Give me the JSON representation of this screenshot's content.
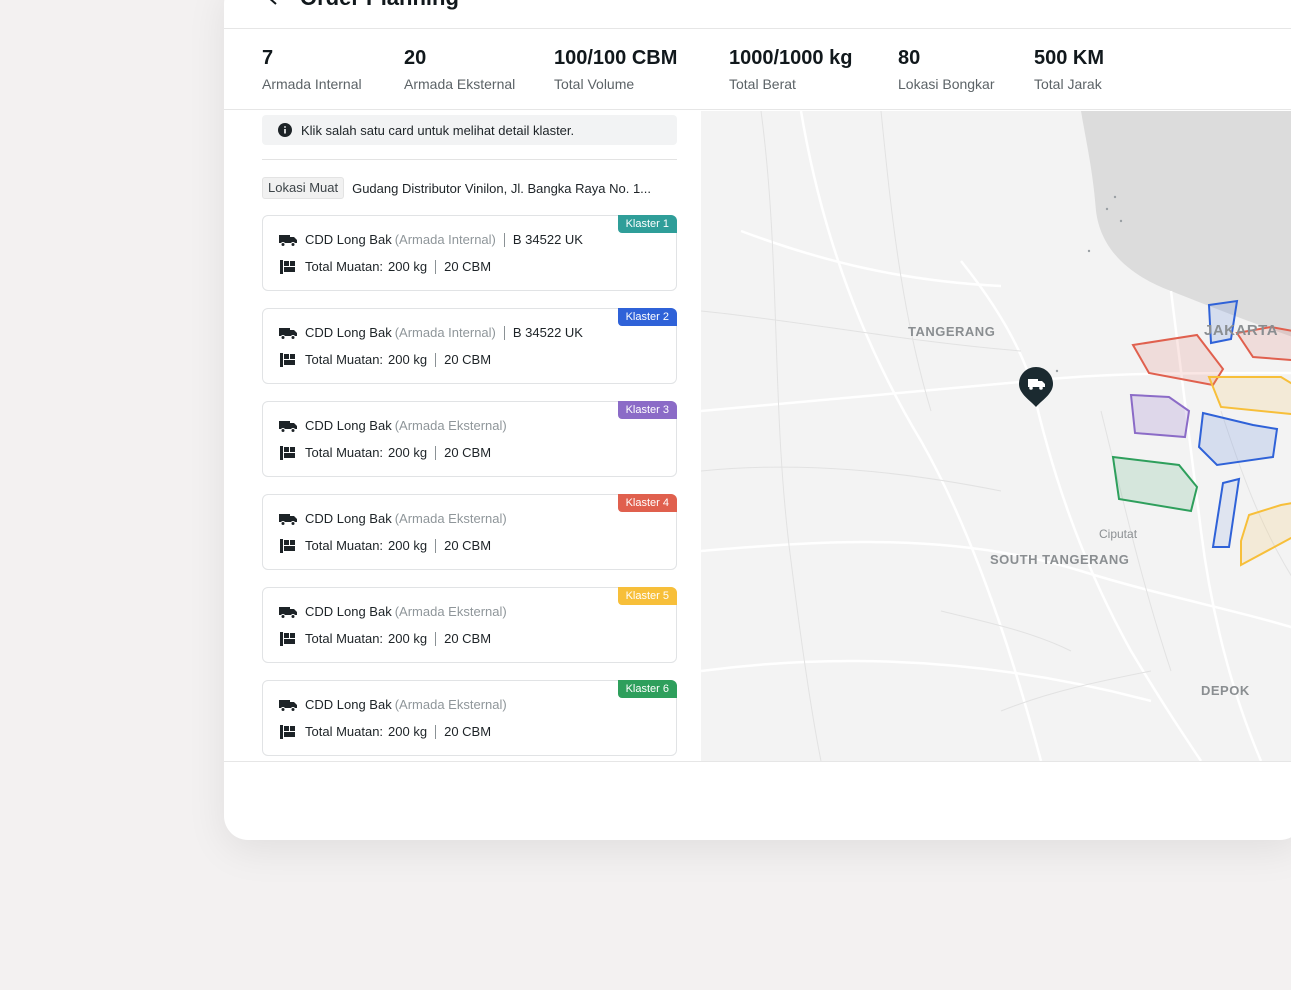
{
  "header": {
    "title": "Order Planning"
  },
  "stats": [
    {
      "value": "7",
      "label": "Armada Internal"
    },
    {
      "value": "20",
      "label": "Armada Eksternal"
    },
    {
      "value": "100/100 CBM",
      "label": "Total Volume"
    },
    {
      "value": "1000/1000 kg",
      "label": "Total Berat"
    },
    {
      "value": "80",
      "label": "Lokasi Bongkar"
    },
    {
      "value": "500 KM",
      "label": "Total Jarak"
    }
  ],
  "info": {
    "text": "Klik salah satu card untuk melihat detail klaster."
  },
  "load": {
    "tag": "Lokasi Muat",
    "address": "Gudang Distributor Vinilon, Jl. Bangka Raya No. 1..."
  },
  "cards": [
    {
      "badge": "Klaster 1",
      "badge_color": "#2f9e99",
      "vehicle": "CDD Long Bak",
      "fleet": "(Armada Internal)",
      "plate": "B 34522 UK",
      "load_label": "Total Muatan:",
      "weight": "200 kg",
      "volume": "20 CBM"
    },
    {
      "badge": "Klaster 2",
      "badge_color": "#2f62d8",
      "vehicle": "CDD Long Bak",
      "fleet": "(Armada Internal)",
      "plate": "B 34522 UK",
      "load_label": "Total Muatan:",
      "weight": "200 kg",
      "volume": "20 CBM"
    },
    {
      "badge": "Klaster 3",
      "badge_color": "#8b6bc7",
      "vehicle": "CDD Long Bak",
      "fleet": "(Armada Eksternal)",
      "plate": "",
      "load_label": "Total Muatan:",
      "weight": "200 kg",
      "volume": "20 CBM"
    },
    {
      "badge": "Klaster 4",
      "badge_color": "#e0604e",
      "vehicle": "CDD Long Bak",
      "fleet": "(Armada Eksternal)",
      "plate": "",
      "load_label": "Total Muatan:",
      "weight": "200 kg",
      "volume": "20 CBM"
    },
    {
      "badge": "Klaster 5",
      "badge_color": "#f7bf3a",
      "vehicle": "CDD Long Bak",
      "fleet": "(Armada Eksternal)",
      "plate": "",
      "load_label": "Total Muatan:",
      "weight": "200 kg",
      "volume": "20 CBM"
    },
    {
      "badge": "Klaster 6",
      "badge_color": "#2e9f5c",
      "vehicle": "CDD Long Bak",
      "fleet": "(Armada Eksternal)",
      "plate": "",
      "load_label": "Total Muatan:",
      "weight": "200 kg",
      "volume": "20 CBM"
    }
  ],
  "map": {
    "labels": {
      "tangerang": "TANGERANG",
      "jakarta": "JAKARTA",
      "south_tangerang": "SOUTH TANGERANG",
      "ciputat": "Ciputat",
      "depok": "DEPOK"
    }
  }
}
